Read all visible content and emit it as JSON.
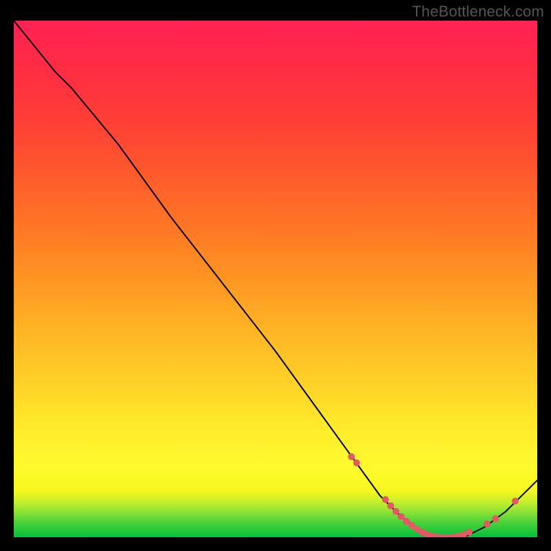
{
  "watermark": "TheBottleneck.com",
  "chart_data": {
    "type": "line",
    "title": "",
    "xlabel": "",
    "ylabel": "",
    "xlim": [
      0,
      100
    ],
    "ylim": [
      0,
      100
    ],
    "grid": false,
    "legend": false,
    "series": [
      {
        "name": "curve",
        "x": [
          0,
          8,
          11,
          20,
          30,
          40,
          50,
          60,
          65,
          70,
          74,
          78,
          82,
          86,
          90,
          94,
          98,
          100
        ],
        "values": [
          100,
          90,
          87,
          76,
          62,
          49,
          36,
          22,
          15,
          8,
          4,
          1,
          0,
          0,
          2,
          5,
          9,
          11
        ]
      }
    ],
    "markers": {
      "name": "dots",
      "color": "#e15a64",
      "x": [
        64.5,
        65.5,
        71.0,
        72.0,
        73.0,
        74.0,
        75.0,
        76.0,
        77.0,
        78.0,
        79.0,
        80.0,
        81.0,
        82.0,
        83.0,
        84.0,
        85.0,
        86.0,
        87.0,
        90.4,
        92.0,
        95.8
      ],
      "values": [
        15.6,
        14.4,
        7.3,
        6.1,
        5.0,
        4.0,
        3.1,
        2.3,
        1.6,
        1.0,
        0.6,
        0.3,
        0.1,
        0.0,
        0.0,
        0.1,
        0.3,
        0.6,
        1.0,
        2.6,
        3.6,
        7.0
      ]
    }
  }
}
